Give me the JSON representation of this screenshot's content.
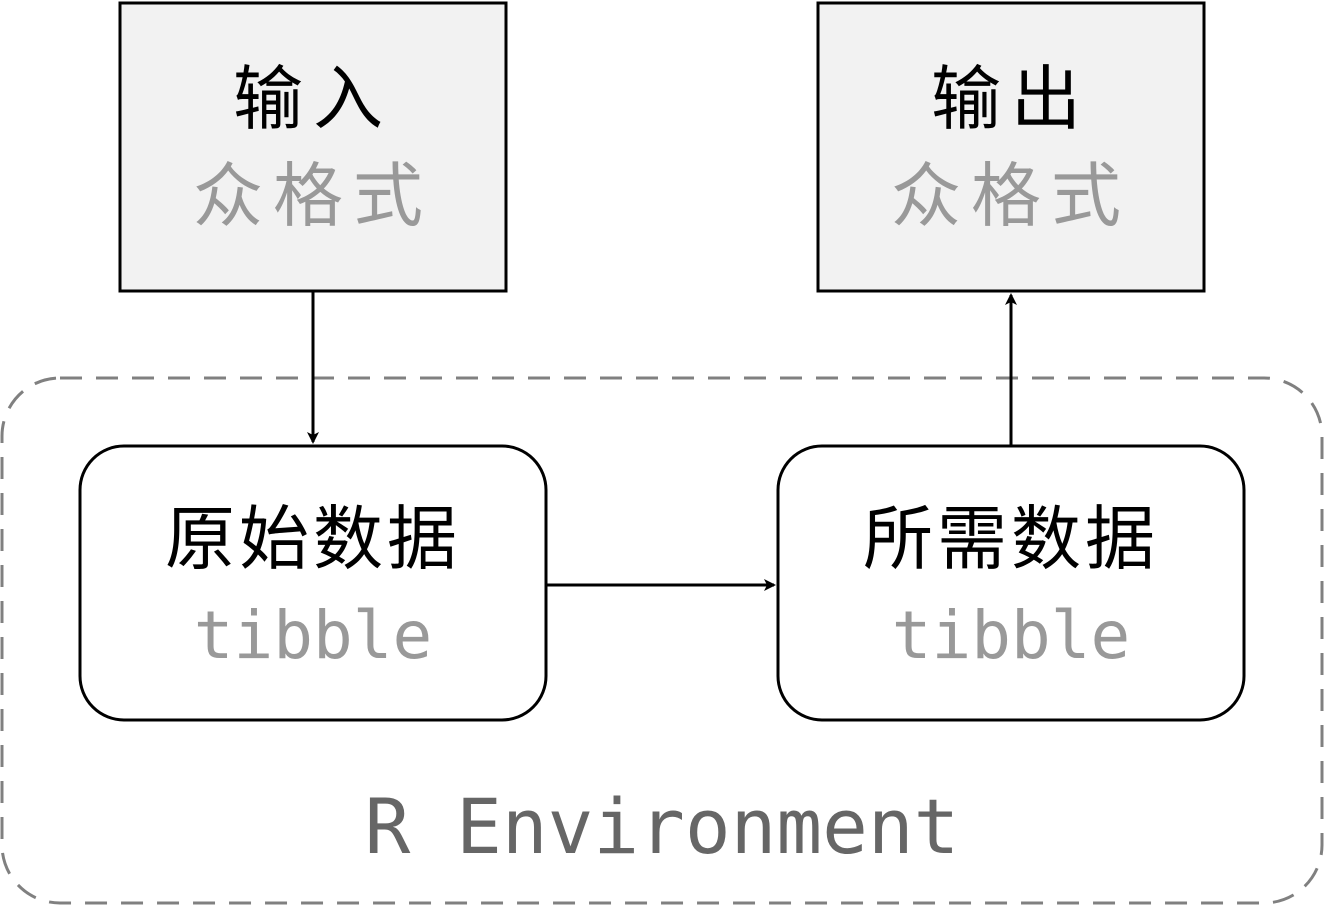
{
  "input_box": {
    "title": "输入",
    "subtitle": "众格式"
  },
  "output_box": {
    "title": "输出",
    "subtitle": "众格式"
  },
  "raw_data_box": {
    "title": "原始数据",
    "subtitle": "tibble"
  },
  "target_data_box": {
    "title": "所需数据",
    "subtitle": "tibble"
  },
  "environment": {
    "label": "R Environment"
  },
  "colors": {
    "stroke": "#000000",
    "io_fill": "#f2f2f2",
    "node_fill": "#ffffff",
    "muted_text": "#999999",
    "env_border": "#808080",
    "env_text": "#666666"
  }
}
